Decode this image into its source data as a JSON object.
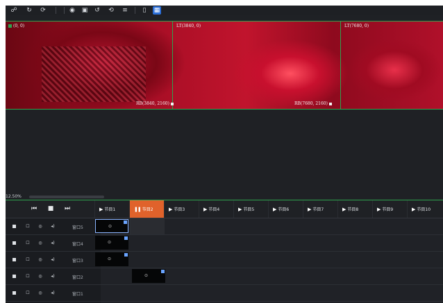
{
  "toolbar": {
    "icons": [
      "link-icon",
      "redo-icon",
      "refresh-icon",
      "record-icon",
      "folder-icon",
      "undo-icon",
      "rotate-icon",
      "list-icon",
      "phone-icon",
      "screen-icon"
    ]
  },
  "preview": {
    "labels": {
      "top_left": "(0, 0)",
      "lt_mid": "LT(3840, 0)",
      "lt_right": "LT(7680, 0)",
      "rb_mid": "RB(3840, 2160)",
      "rb_right": "RB(7680, 2160)"
    }
  },
  "canvas": {
    "zoom": "12.50%"
  },
  "timeline": {
    "columns": [
      "节目1",
      "节目2",
      "节目3",
      "节目4",
      "节目5",
      "节目6",
      "节目7",
      "节目8",
      "节目9",
      "节目10"
    ],
    "active_column_index": 1,
    "windows": [
      "窗口5",
      "窗口4",
      "窗口3",
      "窗口2",
      "窗口1"
    ],
    "clip_glyph": "⊙"
  },
  "colors": {
    "accent": "#e0622b",
    "border_green": "#2ea44f",
    "select_blue": "#2c6fd8"
  }
}
